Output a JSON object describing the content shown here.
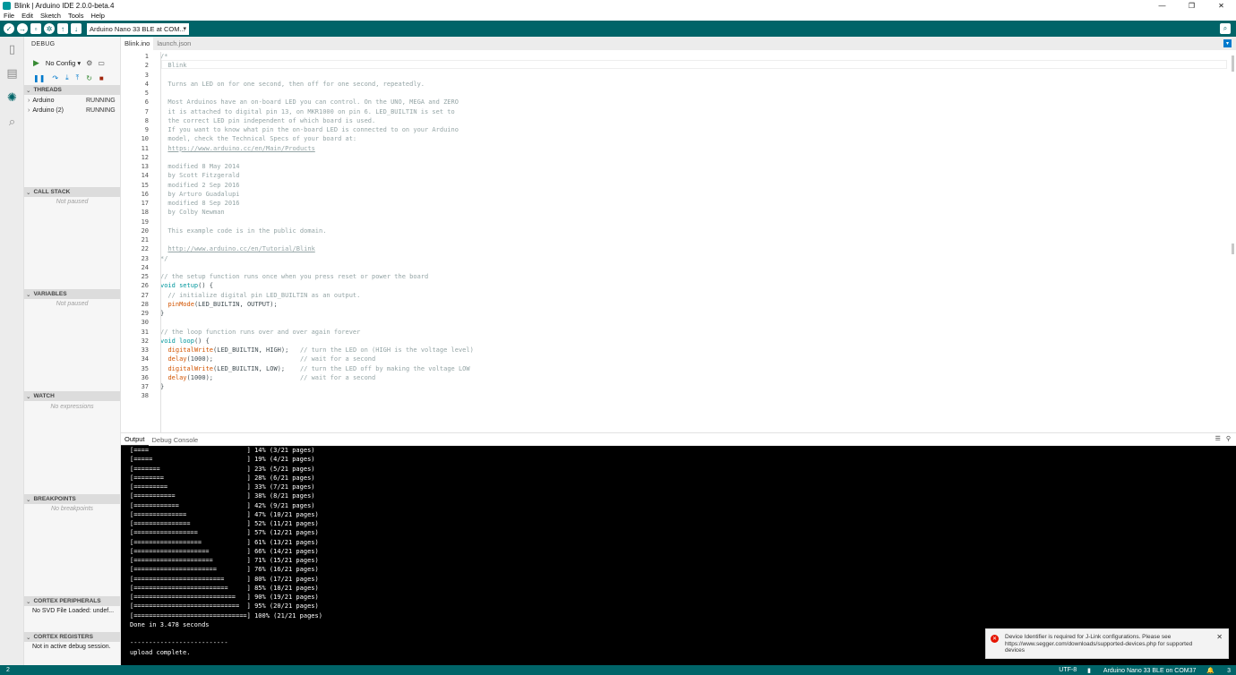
{
  "window": {
    "title": "Blink | Arduino IDE 2.0.0-beta.4",
    "controls": [
      "—",
      "❐",
      "✕"
    ]
  },
  "menu": [
    "File",
    "Edit",
    "Sketch",
    "Tools",
    "Help"
  ],
  "toolbar": {
    "board": "Arduino Nano 33 BLE at COM...",
    "buttons": [
      "verify",
      "upload",
      "new",
      "debug",
      "open",
      "save"
    ]
  },
  "sidebar": {
    "title": "DEBUG",
    "config": "No Config",
    "sections": {
      "threads": "THREADS",
      "call_stack": "CALL STACK",
      "variables": "VARIABLES",
      "watch": "WATCH",
      "breakpoints": "BREAKPOINTS",
      "cortex_peripherals": "CORTEX PERIPHERALS",
      "cortex_registers": "CORTEX REGISTERS"
    },
    "threads": [
      {
        "name": "Arduino",
        "state": "RUNNING"
      },
      {
        "name": "Arduino (2)",
        "state": "RUNNING"
      }
    ],
    "call_stack_placeholder": "Not paused",
    "variables_placeholder": "Not paused",
    "watch_placeholder": "No expressions",
    "breakpoints_placeholder": "No breakpoints",
    "peripherals_info": "No SVD File Loaded: undef...",
    "registers_info": "Not in active debug session."
  },
  "editor": {
    "tabs": [
      "Blink.ino",
      "launch.json"
    ],
    "lines": [
      "/*",
      "  Blink",
      "",
      "  Turns an LED on for one second, then off for one second, repeatedly.",
      "",
      "  Most Arduinos have an on-board LED you can control. On the UNO, MEGA and ZERO",
      "  it is attached to digital pin 13, on MKR1000 on pin 6. LED_BUILTIN is set to",
      "  the correct LED pin independent of which board is used.",
      "  If you want to know what pin the on-board LED is connected to on your Arduino",
      "  model, check the Technical Specs of your board at:",
      "  https://www.arduino.cc/en/Main/Products",
      "",
      "  modified 8 May 2014",
      "  by Scott Fitzgerald",
      "  modified 2 Sep 2016",
      "  by Arturo Guadalupi",
      "  modified 8 Sep 2016",
      "  by Colby Newman",
      "",
      "  This example code is in the public domain.",
      "",
      "  http://www.arduino.cc/en/Tutorial/Blink",
      "*/",
      "",
      "// the setup function runs once when you press reset or power the board",
      "void setup() {",
      "  // initialize digital pin LED_BUILTIN as an output.",
      "  pinMode(LED_BUILTIN, OUTPUT);",
      "}",
      "",
      "// the loop function runs over and over again forever",
      "void loop() {",
      "  digitalWrite(LED_BUILTIN, HIGH);   // turn the LED on (HIGH is the voltage level)",
      "  delay(1000);                       // wait for a second",
      "  digitalWrite(LED_BUILTIN, LOW);    // turn the LED off by making the voltage LOW",
      "  delay(1000);                       // wait for a second",
      "}",
      ""
    ]
  },
  "panel": {
    "tabs": [
      "Output",
      "Debug Console"
    ],
    "output": [
      "[====                          ] 14% (3/21 pages)",
      "[=====                         ] 19% (4/21 pages)",
      "[=======                       ] 23% (5/21 pages)",
      "[========                      ] 28% (6/21 pages)",
      "[=========                     ] 33% (7/21 pages)",
      "[===========                   ] 38% (8/21 pages)",
      "[============                  ] 42% (9/21 pages)",
      "[==============                ] 47% (10/21 pages)",
      "[===============               ] 52% (11/21 pages)",
      "[=================             ] 57% (12/21 pages)",
      "[==================            ] 61% (13/21 pages)",
      "[====================          ] 66% (14/21 pages)",
      "[=====================         ] 71% (15/21 pages)",
      "[======================        ] 76% (16/21 pages)",
      "[========================      ] 80% (17/21 pages)",
      "[=========================     ] 85% (18/21 pages)",
      "[===========================   ] 90% (19/21 pages)",
      "[============================  ] 95% (20/21 pages)",
      "[==============================] 100% (21/21 pages)",
      "Done in 3.478 seconds",
      "",
      "--------------------------",
      "upload complete."
    ]
  },
  "notification": {
    "message": "Device Identifier is required for J-Link configurations. Please see https://www.segger.com/downloads/supported-devices.php for supported devices"
  },
  "status": {
    "left": "2",
    "encoding": "UTF-8",
    "board": "Arduino Nano 33 BLE on COM37",
    "notifications": "3"
  },
  "colors": {
    "brand": "#006468",
    "keyword": "#00979d",
    "function": "#d35400",
    "comment": "#95a5a6"
  }
}
